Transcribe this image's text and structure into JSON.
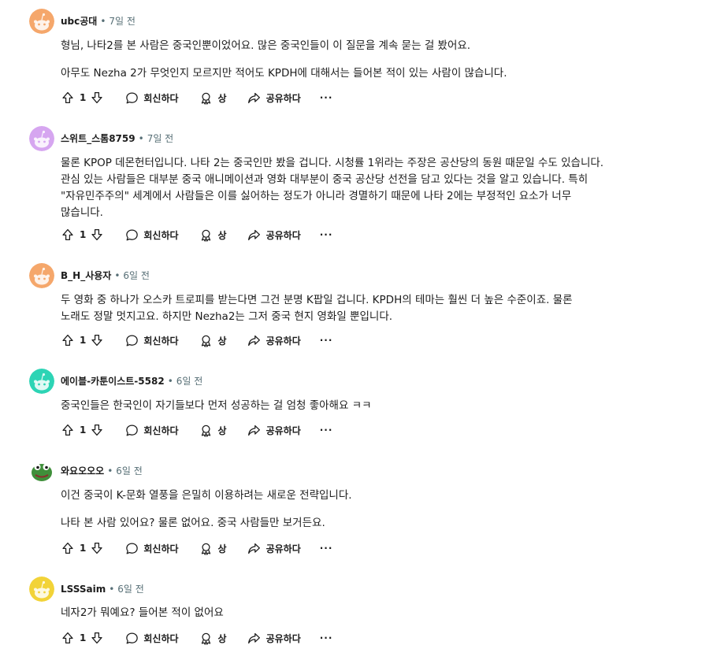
{
  "actions": {
    "reply": "회신하다",
    "award": "상",
    "share": "공유하다",
    "more": "···"
  },
  "comments": [
    {
      "author": "ubc공대",
      "time": "7일 전",
      "avatar_color": "#f5a76b",
      "avatar_icon": "snoo-default",
      "paragraphs": [
        "형님, 나타2를 본 사람은 중국인뿐이었어요. 많은 중국인들이 이 질문을 계속 묻는 걸 봤어요.",
        "아무도 Nezha 2가 무엇인지 모르지만 적어도 KPDH에 대해서는 들어본 적이 있는 사람이 많습니다."
      ],
      "votes": "1"
    },
    {
      "author": "스위트_스톰8759",
      "time": "7일 전",
      "avatar_color": "#d6a6f0",
      "avatar_icon": "snoo-default",
      "paragraphs": [
        "물론 KPOP 데몬헌터입니다. 나타 2는 중국인만 봤을 겁니다. 시청률 1위라는 주장은 공산당의 동원 때문일 수도 있습니다. 관심 있는 사람들은 대부분 중국 애니메이션과 영화 대부분이 중국 공산당 선전을 담고 있다는 것을 알고 있습니다. 특히 \"자유민주주의\" 세계에서 사람들은 이를 싫어하는 정도가 아니라 경멸하기 때문에 나타 2에는 부정적인 요소가 너무 많습니다."
      ],
      "votes": "1"
    },
    {
      "author": "B_H_사용자",
      "time": "6일 전",
      "avatar_color": "#f5a76b",
      "avatar_icon": "snoo-default",
      "paragraphs": [
        "두 영화 중 하나가 오스카 트로피를 받는다면 그건 분명 K팝일 겁니다. KPDH의 테마는 훨씬 더 높은 수준이죠. 물론 노래도 정말 멋지고요. 하지만 Nezha2는 그저 중국 현지 영화일 뿐입니다."
      ],
      "votes": "1"
    },
    {
      "author": "에이블-카툰이스트-5582",
      "time": "6일 전",
      "avatar_color": "#2dd4b5",
      "avatar_icon": "snoo-default",
      "paragraphs": [
        "중국인들은 한국인이 자기들보다 먼저 성공하는 걸 엄청 좋아해요 ㅋㅋ"
      ],
      "votes": "1"
    },
    {
      "author": "와요오오오",
      "time": "6일 전",
      "avatar_color": "#3f8f3a",
      "avatar_icon": "frog-avatar",
      "paragraphs": [
        "이건 중국이 K-문화 열풍을 은밀히 이용하려는 새로운 전략입니다.",
        "나타 본 사람 있어요? 물론 없어요. 중국 사람들만 보거든요."
      ],
      "votes": "1"
    },
    {
      "author": "LSSSaim",
      "time": "6일 전",
      "avatar_color": "#f2d338",
      "avatar_icon": "snoo-default",
      "paragraphs": [
        "네자2가 뭐예요? 들어본 적이 없어요"
      ],
      "votes": "1"
    }
  ]
}
